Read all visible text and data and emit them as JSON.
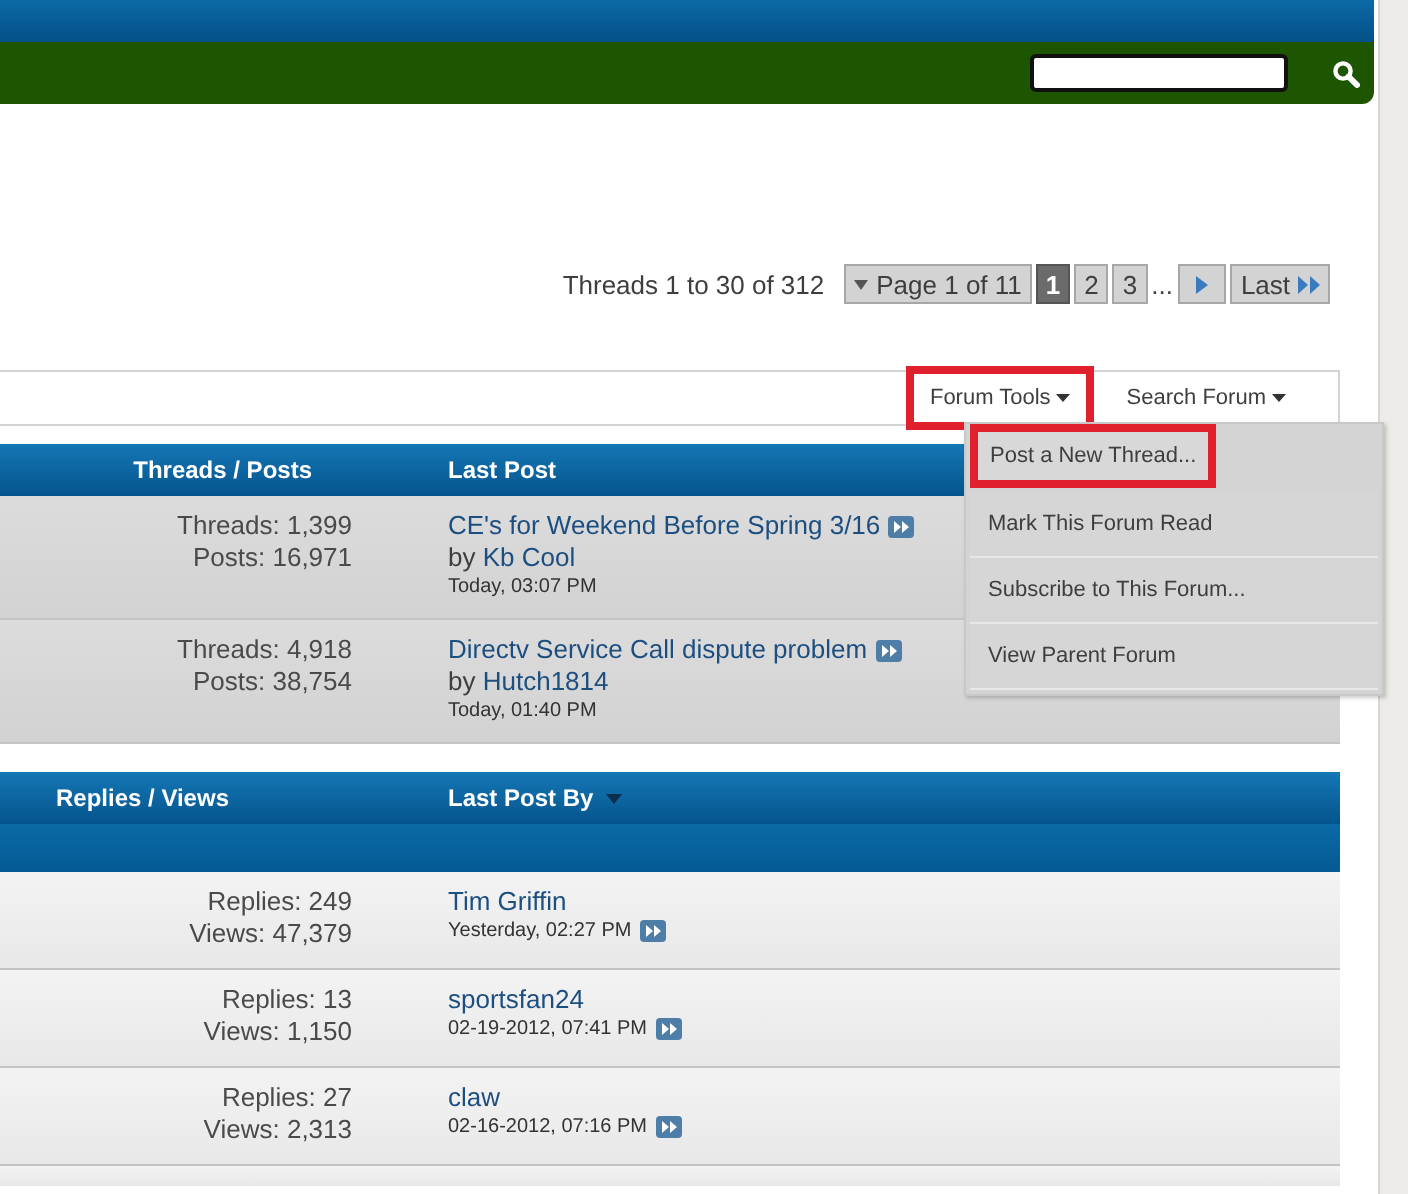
{
  "thread_count": "Threads 1 to 30 of 312",
  "pagination": {
    "page_menu": "Page 1 of 11",
    "pages": [
      {
        "label": "1",
        "selected": true
      },
      {
        "label": "2",
        "selected": false
      },
      {
        "label": "3",
        "selected": false
      }
    ],
    "ellipsis": "...",
    "last": "Last"
  },
  "toolbar": [
    {
      "label": "Forum Tools",
      "highlighted": true
    },
    {
      "label": "Search Forum",
      "highlighted": false
    }
  ],
  "forum_tools_menu": [
    {
      "label": "Post a New Thread...",
      "highlighted": true
    },
    {
      "label": "Mark This Forum Read",
      "highlighted": false
    },
    {
      "label": "Subscribe to This Forum...",
      "highlighted": false
    },
    {
      "label": "View Parent Forum",
      "highlighted": false
    }
  ],
  "forum_table": {
    "columns": [
      "Threads / Posts",
      "Last Post"
    ],
    "rows": [
      {
        "stat_1": "Threads: 1,399",
        "stat_2": "Posts: 16,971",
        "title": "CE's for Weekend Before Spring 3/16",
        "by": "by",
        "author": "Kb Cool",
        "time": "Today, 03:07 PM"
      },
      {
        "stat_1": "Threads: 4,918",
        "stat_2": "Posts: 38,754",
        "title": "Directv Service Call dispute problem",
        "by": "by",
        "author": "Hutch1814",
        "time": "Today, 01:40 PM"
      }
    ]
  },
  "thread_table": {
    "columns": [
      "Replies / Views",
      "Last Post By"
    ],
    "rows": [
      {
        "stat_1": "Replies: 249",
        "stat_2": "Views: 47,379",
        "author": "Tim Griffin",
        "time": "Yesterday, 02:27 PM"
      },
      {
        "stat_1": "Replies: 13",
        "stat_2": "Views: 1,150",
        "author": "sportsfan24",
        "time": "02-19-2012, 07:41 PM"
      },
      {
        "stat_1": "Replies: 27",
        "stat_2": "Views: 2,313",
        "author": "claw",
        "time": "02-16-2012, 07:16 PM"
      }
    ]
  }
}
